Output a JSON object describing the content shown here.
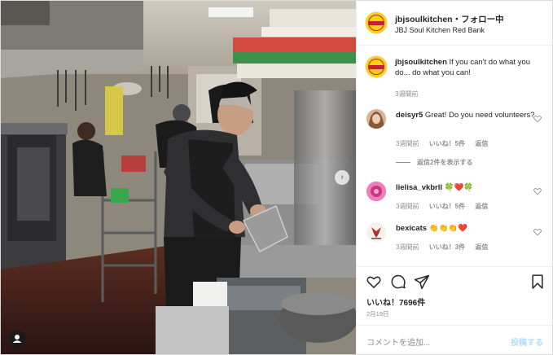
{
  "header": {
    "username": "jbjsoulkitchen",
    "separator": "・",
    "follow_status": "フォロー中",
    "location": "JBJ Soul Kitchen Red Bank",
    "more_icon": "more-dots-icon"
  },
  "caption": {
    "username": "jbjsoulkitchen",
    "text": "If you can't do what you do... do what you can!",
    "time": "3週間前"
  },
  "comments": [
    {
      "username": "deisyr5",
      "text": "Great! Do you need volunteers?",
      "time": "3週間前",
      "likes": "いいね！5件",
      "reply": "返信",
      "view_replies": "返信2件を表示する"
    },
    {
      "username": "lielisa_vkbrll",
      "text": "🍀❤️🍀",
      "time": "3週間前",
      "likes": "いいね！5件",
      "reply": "返信"
    },
    {
      "username": "bexicats",
      "text": "👏👏👏❤️",
      "time": "3週間前",
      "likes": "いいね！3件",
      "reply": "返信"
    }
  ],
  "actions": {
    "like_icon": "heart-icon",
    "comment_icon": "comment-icon",
    "share_icon": "send-icon",
    "save_icon": "bookmark-icon",
    "likes_count": "いいね！7696件",
    "date": "2月19日"
  },
  "add_comment": {
    "placeholder": "コメントを追加...",
    "post_label": "投稿する"
  },
  "colors": {
    "accent": "#0095f6",
    "post_disabled": "#b2dffc",
    "meta_gray": "#8e8e8e",
    "border": "#efefef"
  }
}
